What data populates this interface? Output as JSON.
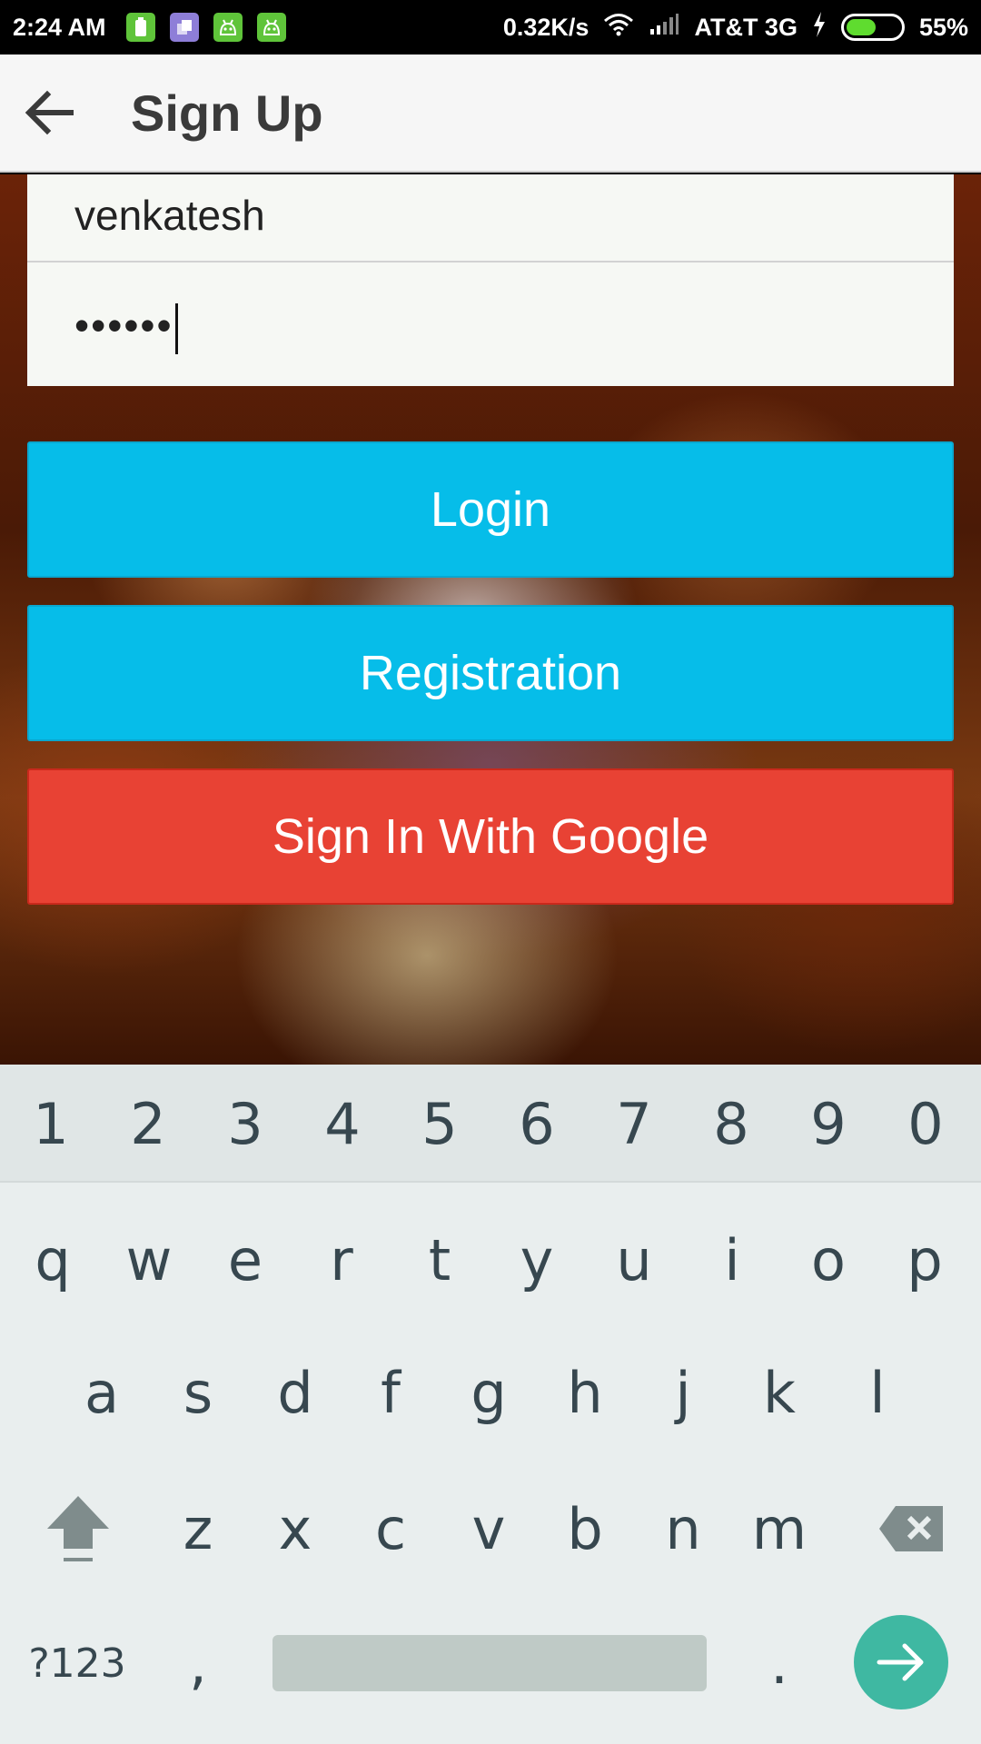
{
  "status_bar": {
    "time": "2:24 AM",
    "net_speed": "0.32K/s",
    "carrier": "AT&T 3G",
    "battery_percent": "55%",
    "battery_level": 0.55
  },
  "toolbar": {
    "title": "Sign Up",
    "back_icon": "arrow-left-icon"
  },
  "form": {
    "username_value": "venkatesh",
    "password_value": "••••••"
  },
  "buttons": {
    "login": "Login",
    "registration": "Registration",
    "google": "Sign In With Google"
  },
  "colors": {
    "accent_blue": "#06bde9",
    "google_red": "#e84234",
    "enter_teal": "#3fb8a2"
  },
  "keyboard": {
    "numbers": [
      "1",
      "2",
      "3",
      "4",
      "5",
      "6",
      "7",
      "8",
      "9",
      "0"
    ],
    "row1": [
      "q",
      "w",
      "e",
      "r",
      "t",
      "y",
      "u",
      "i",
      "o",
      "p"
    ],
    "row2": [
      "a",
      "s",
      "d",
      "f",
      "g",
      "h",
      "j",
      "k",
      "l"
    ],
    "row3": [
      "z",
      "x",
      "c",
      "v",
      "b",
      "n",
      "m"
    ],
    "symbols_key": "?123",
    "comma_key": ",",
    "period_key": ".",
    "shift_icon": "shift-arrow-icon",
    "backspace_icon": "backspace-icon",
    "enter_icon": "arrow-right-icon"
  }
}
